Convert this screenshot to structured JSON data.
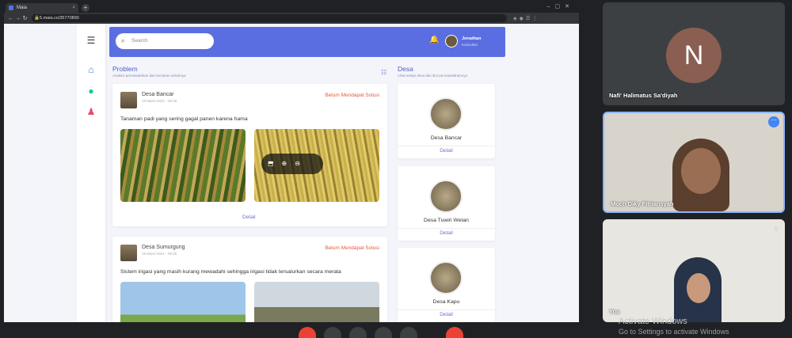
{
  "browser": {
    "tab_title": "Maia",
    "url": "5.maia.co/35770890"
  },
  "app": {
    "search_placeholder": "Search",
    "user_name": "Jonathan",
    "user_role": "Konsultan"
  },
  "problem_section": {
    "title": "Problem",
    "subtitle": "Analisis permasalahan dan temukan solusinya",
    "cards": [
      {
        "village": "Desa Bancar",
        "date": "19 Maret 2021 - 08:30",
        "status": "Belum Mendapat Solusi",
        "description": "Tanaman padi yang sering gagal panen karena hama",
        "detail": "Detail"
      },
      {
        "village": "Desa Sumurgung",
        "date": "19 Maret 2021 - 08:30",
        "status": "Belum Mendapat Solusi",
        "description": "Sistem irigasi yang masih kurang mewadahi sehingga irigasi tidak tersalurkan secara merata"
      }
    ]
  },
  "desa_section": {
    "title": "Desa",
    "subtitle": "Lihat setiap desa dan ikut permasalahannya",
    "cards": [
      {
        "name": "Desa Bancar",
        "detail": "Detail"
      },
      {
        "name": "Desa Tuwiri Wetan",
        "detail": "Detail"
      },
      {
        "name": "Desa Kapu",
        "detail": "Detail"
      }
    ]
  },
  "meeting": {
    "participants": [
      {
        "name": "Nafi' Halimatus Sa'diyah",
        "initial": "N"
      },
      {
        "name": "Moch Diky Fitriansyah"
      },
      {
        "name": "You"
      }
    ],
    "watermark_line1": "Activate Windows",
    "watermark_line2": "Go to Settings to activate Windows"
  },
  "colors": {
    "accent": "#5b6ee1",
    "status": "#e55b3c"
  }
}
